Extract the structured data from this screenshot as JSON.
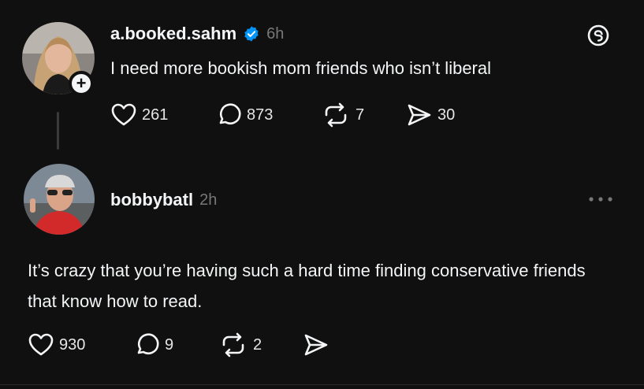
{
  "post": {
    "username": "a.booked.sahm",
    "verified": true,
    "time": "6h",
    "text": "I need more bookish mom friends who isn’t liberal",
    "follow_badge": "+",
    "likes": "261",
    "replies": "873",
    "reposts": "7",
    "shares": "30"
  },
  "reply": {
    "username": "bobbybatl",
    "time": "2h",
    "text": "It’s crazy that you’re having such a hard time finding conservative friends that know how to read.",
    "likes": "930",
    "replies": "9",
    "reposts": "2"
  },
  "icons": {
    "verified": "verified-badge-icon",
    "threads": "threads-logo-icon",
    "like": "heart-icon",
    "reply": "comment-icon",
    "repost": "repost-icon",
    "share": "send-icon",
    "more": "more-dots-icon"
  },
  "colors": {
    "background": "#101010",
    "verified": "#0095f6",
    "text": "#f3f5f7",
    "muted": "#777777"
  }
}
